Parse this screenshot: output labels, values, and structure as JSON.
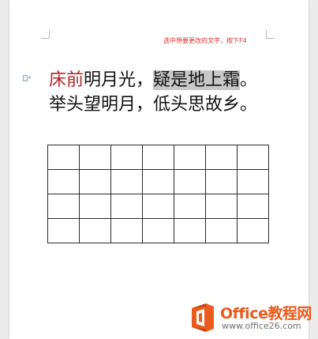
{
  "hint": "选中想要更改的文字，按下F4",
  "poem": {
    "line1": {
      "red": "床前",
      "normal": "明月光，",
      "selected": "疑是地上霜",
      "end": "。"
    },
    "line2": "举头望明月，低头思故乡。"
  },
  "table": {
    "rows": 4,
    "cols": 7
  },
  "watermark": {
    "name": "Office教程网",
    "url": "www.office26.com",
    "brand_color": "#eb5b1d"
  },
  "icons": {
    "paragraph_mark": "document-arrow-icon",
    "logo": "office-logo-icon"
  }
}
